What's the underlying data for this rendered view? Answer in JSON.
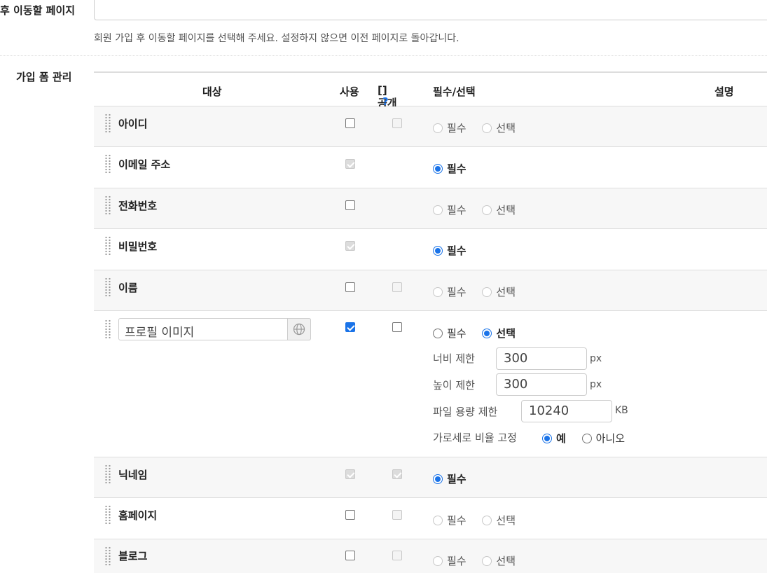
{
  "top": {
    "label": "후 이동할 페이지",
    "help": "회원 가입 후 이동할 페이지를 선택해 주세요. 설정하지 않으면 이전 페이지로 돌아갑니다."
  },
  "section": {
    "label": "가입 폼 관리"
  },
  "table": {
    "headers": {
      "target": "대상",
      "use": "사용",
      "public": "공개",
      "public_help": "?",
      "required": "필수/선택",
      "description": "설명"
    },
    "rows": [
      {
        "name": "아이디",
        "use": "unchecked",
        "public": "disabled",
        "required_label": "필수",
        "optional_label": "선택"
      },
      {
        "name": "이메일 주소",
        "use": "checked-disabled",
        "required_label": "필수"
      },
      {
        "name": "전화번호",
        "use": "unchecked",
        "required_label": "필수",
        "optional_label": "선택"
      },
      {
        "name": "비밀번호",
        "use": "checked-disabled",
        "required_label": "필수"
      },
      {
        "name": "이름",
        "use": "unchecked",
        "public": "disabled",
        "required_label": "필수",
        "optional_label": "선택"
      },
      {
        "name": "프로필 이미지",
        "use": "checked",
        "public": "unchecked",
        "required_label": "필수",
        "optional_label": "선택",
        "width_label": "너비 제한",
        "width_value": "300",
        "height_label": "높이 제한",
        "height_value": "300",
        "size_label": "파일 용량 제한",
        "size_value": "10240",
        "px_unit": "px",
        "kb_unit": "KB",
        "ratio_label": "가로세로 비율 고정",
        "ratio_yes": "예",
        "ratio_no": "아니오"
      },
      {
        "name": "닉네임",
        "use": "checked-disabled",
        "public": "checked-disabled",
        "required_label": "필수"
      },
      {
        "name": "홈페이지",
        "use": "unchecked",
        "public": "disabled",
        "required_label": "필수",
        "optional_label": "선택"
      },
      {
        "name": "블로그",
        "use": "unchecked",
        "public": "disabled",
        "required_label": "필수",
        "optional_label": "선택"
      }
    ]
  },
  "colors": {
    "accent": "#1a73e8",
    "alt_row": "#f7f7f7",
    "border": "#dddddd"
  }
}
